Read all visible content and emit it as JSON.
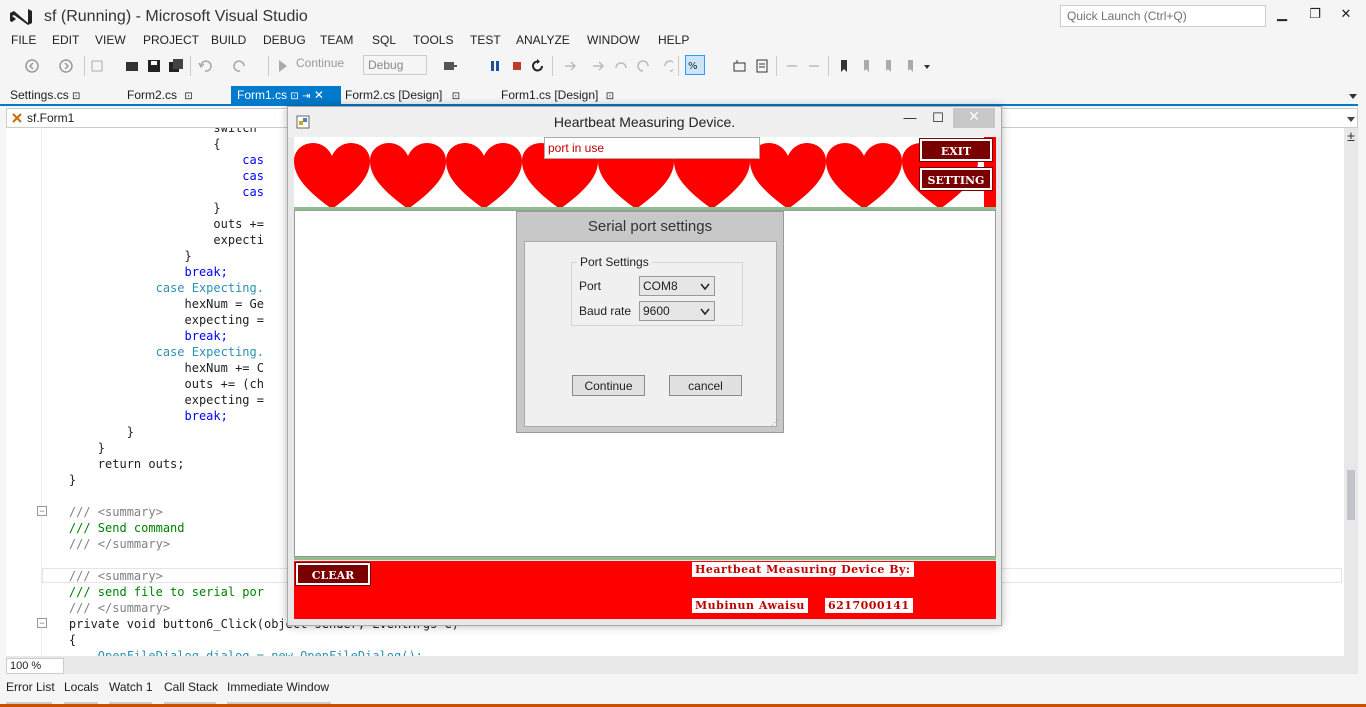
{
  "window": {
    "title": "sf (Running) - Microsoft Visual Studio",
    "quick_launch_placeholder": "Quick Launch (Ctrl+Q)",
    "min": "▁",
    "max": "❐",
    "close": "✕"
  },
  "menu": [
    "FILE",
    "EDIT",
    "VIEW",
    "PROJECT",
    "BUILD",
    "DEBUG",
    "TEAM",
    "SQL",
    "TOOLS",
    "TEST",
    "ANALYZE",
    "WINDOW",
    "HELP"
  ],
  "toolbar": {
    "continue_label": "Continue",
    "config": "Debug"
  },
  "tabs": [
    {
      "label": "Settings.cs"
    },
    {
      "label": "Form2.cs"
    },
    {
      "label": "Form1.cs"
    },
    {
      "label": "Form2.cs [Design]"
    },
    {
      "label": "Form1.cs [Design]"
    }
  ],
  "navbar": {
    "text": "sf.Form1"
  },
  "editor": {
    "zoom": "100 %",
    "lines": [
      "                        switch",
      "                        {",
      "                            cas",
      "                            cas",
      "                            cas",
      "                        }",
      "                        outs +=",
      "                        expecti",
      "                    }",
      "                    break;",
      "                case Expecting.",
      "                    hexNum = Ge",
      "                    expecting =",
      "                    break;",
      "                case Expecting.",
      "                    hexNum += C",
      "                    outs += (ch",
      "                    expecting =",
      "                    break;",
      "            }",
      "        }",
      "        return outs;",
      "    }",
      "",
      "    /// <summary>",
      "    /// Send command",
      "    /// </summary>",
      "",
      "    /// <summary>",
      "    /// send file to serial por",
      "    /// </summary>",
      "    private void button6_Click(object sender, EventArgs e)",
      "    {",
      "        OpenFileDialog dialog = new OpenFileDialog();"
    ]
  },
  "bottom_tabs": [
    "Error List",
    "Locals",
    "Watch 1",
    "Call Stack",
    "Immediate Window"
  ],
  "form": {
    "title": "Heartbeat Measuring Device.",
    "min": "—",
    "max": "☐",
    "close": "✕",
    "port_status": "port in use",
    "exit_label": "EXIT",
    "setting_label": "SETTING",
    "clear_label": "CLEAR",
    "credit_title": "Heartbeat Measuring Device By:",
    "author": "Mubinun Awaisu",
    "student_id": "6217000141"
  },
  "dialog": {
    "title": "Serial port settings",
    "group_title": "Port Settings",
    "port_label": "Port",
    "port_value": "COM8",
    "baud_label": "Baud rate",
    "baud_value": "9600",
    "continue_label": "Continue",
    "cancel_label": "cancel"
  },
  "colors": {
    "accent": "#007acc",
    "heart_red": "#ff0000",
    "dark_red": "#7a0000"
  }
}
